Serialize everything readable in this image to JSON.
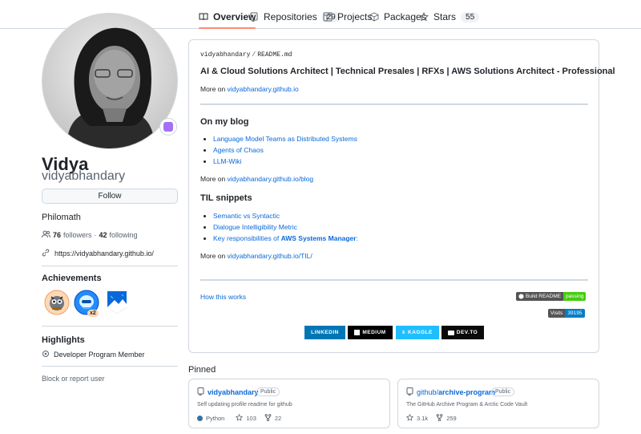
{
  "nav": {
    "tabs": [
      {
        "label": "Overview",
        "count": null
      },
      {
        "label": "Repositories",
        "count": "29"
      },
      {
        "label": "Projects",
        "count": null
      },
      {
        "label": "Packages",
        "count": null
      },
      {
        "label": "Stars",
        "count": "55"
      }
    ]
  },
  "profile": {
    "name": "Vidya",
    "login": "vidyabhandary",
    "follow_label": "Follow",
    "bio": "Philomath",
    "followers_count": "76",
    "followers_label": "followers",
    "separator": "·",
    "following_count": "42",
    "following_label": "following",
    "website": "https://vidyabhandary.github.io/",
    "achievements_title": "Achievements",
    "achievement_multiplier": "x2",
    "highlights_title": "Highlights",
    "highlight_item": "Developer Program Member",
    "block_label": "Block or report user"
  },
  "readme": {
    "path_owner": "vidyabhandary",
    "path_sep": "/",
    "path_file": "README.md",
    "headline": "AI & Cloud Solutions Architect | Technical Presales | RFXs | AWS Solutions Architect - Professional",
    "more_on_1_prefix": "More on ",
    "more_on_1_link": "vidyabhandary.github.io",
    "blog_heading": "On my blog",
    "blog_items": [
      "Language Model Teams as Distributed Systems",
      "Agents of Chaos",
      "LLM-Wiki"
    ],
    "more_on_2_prefix": "More on ",
    "more_on_2_link": "vidyabhandary.github.io/blog",
    "til_heading": "TIL snippets",
    "til_items": [
      "Semantic vs Syntactic",
      "Dialogue Intelligibility Metric"
    ],
    "til_item3_prefix": "Key responsibilities of ",
    "til_item3_bold": "AWS Systems Manager",
    "til_item3_suffix": ":",
    "more_on_3_prefix": "More on ",
    "more_on_3_link": "vidyabhandary.github.io/TIL/",
    "how_link": "How this works",
    "build_badge_label": "Build README",
    "build_badge_status": "passing",
    "visits_label": "Visits",
    "visits_count": "39195",
    "social": [
      "LINKEDIN",
      "MEDIUM",
      "KAGGLE",
      "DEV.TO"
    ]
  },
  "pinned": {
    "title": "Pinned",
    "repos": [
      {
        "owner": "",
        "name": "vidyabhandary",
        "visibility": "Public",
        "description": "Self updating profile readme for github",
        "language": "Python",
        "stars": "103",
        "forks": "22"
      },
      {
        "owner": "github/",
        "name": "archive-program",
        "visibility": "Public",
        "description": "The GitHub Archive Program & Arctic Code Vault",
        "language": "",
        "stars": "3.1k",
        "forks": "259"
      }
    ]
  },
  "colors": {
    "accent": "#0969da",
    "tab_underline": "#fd8c73",
    "python": "#3572a5",
    "badge_pass": "#4c1"
  }
}
